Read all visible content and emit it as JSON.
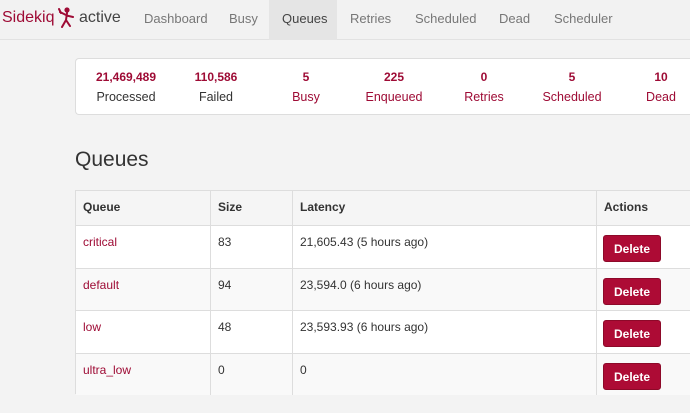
{
  "brand": {
    "name": "Sidekiq",
    "status": "active"
  },
  "nav": {
    "items": [
      {
        "label": "Dashboard"
      },
      {
        "label": "Busy"
      },
      {
        "label": "Queues"
      },
      {
        "label": "Retries"
      },
      {
        "label": "Scheduled"
      },
      {
        "label": "Dead"
      },
      {
        "label": "Scheduler"
      }
    ],
    "active": "Queues"
  },
  "summary": [
    {
      "count": "21,469,489",
      "label": "Processed"
    },
    {
      "count": "110,586",
      "label": "Failed"
    },
    {
      "count": "5",
      "label": "Busy"
    },
    {
      "count": "225",
      "label": "Enqueued"
    },
    {
      "count": "0",
      "label": "Retries"
    },
    {
      "count": "5",
      "label": "Scheduled"
    },
    {
      "count": "10",
      "label": "Dead"
    }
  ],
  "page_title": "Queues",
  "table": {
    "headers": {
      "queue": "Queue",
      "size": "Size",
      "latency": "Latency",
      "actions": "Actions"
    },
    "rows": [
      {
        "name": "critical",
        "size": "83",
        "latency": "21,605.43 (5 hours ago)",
        "action": "Delete"
      },
      {
        "name": "default",
        "size": "94",
        "latency": "23,594.0 (6 hours ago)",
        "action": "Delete"
      },
      {
        "name": "low",
        "size": "48",
        "latency": "23,593.93 (6 hours ago)",
        "action": "Delete"
      },
      {
        "name": "ultra_low",
        "size": "0",
        "latency": "0",
        "action": "Delete"
      }
    ]
  },
  "colors": {
    "brand": "#9e0b35",
    "button": "#ad0b35",
    "page_bg": "#f3f3f3"
  },
  "icons": {
    "brand_logo": "ninja-icon"
  }
}
